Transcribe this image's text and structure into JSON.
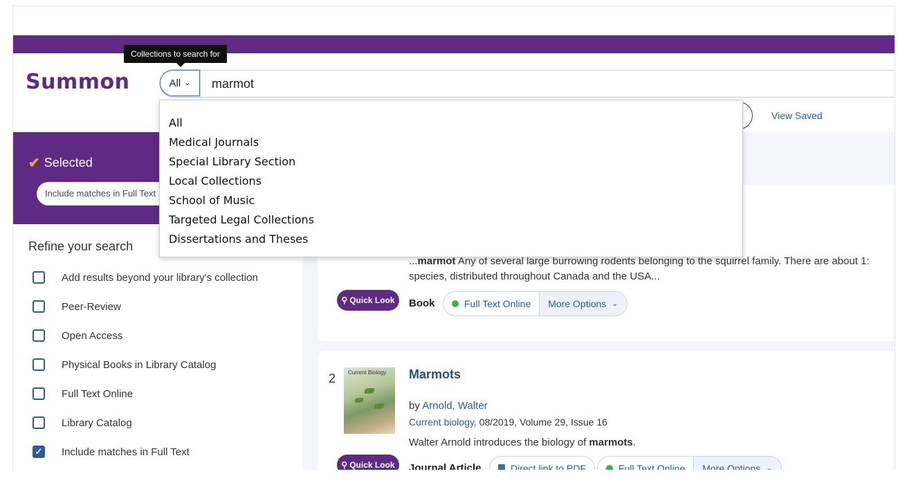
{
  "header": {
    "logo": "Summon",
    "tooltip": "Collections to search for",
    "scope_value": "All",
    "search_value": "marmot",
    "view_saved": "View Saved"
  },
  "scope_options": [
    "All",
    "Medical Journals",
    "Special Library Section",
    "Local Collections",
    "School of Music",
    "Targeted Legal Collections",
    "Dissertations and Theses"
  ],
  "selected": {
    "title": "Selected",
    "chip": "Include matches in Full Text"
  },
  "refine": {
    "title": "Refine your search",
    "facets": [
      {
        "label": "Add results beyond your library's collection",
        "checked": false
      },
      {
        "label": "Peer-Review",
        "checked": false
      },
      {
        "label": "Open Access",
        "checked": false
      },
      {
        "label": "Physical Books in Library Catalog",
        "checked": false
      },
      {
        "label": "Full Text Online",
        "checked": false
      },
      {
        "label": "Library Catalog",
        "checked": false
      },
      {
        "label": "Include matches in Full Text",
        "checked": true
      }
    ]
  },
  "results": [
    {
      "snippet_lead": "...",
      "snippet_bold": "marmot",
      "snippet_rest": " Any of several large burrowing rodents belonging to the squirrel family. There are about 1:",
      "snippet_line2": "species, distributed throughout Canada and the USA...",
      "quick_look": "Quick Look",
      "type": "Book",
      "full_text": "Full Text Online",
      "more_options": "More Options"
    },
    {
      "rank": "2",
      "thumb_title": "Current Biology",
      "title": "Marmots",
      "by": "by ",
      "author": "Arnold, Walter",
      "journal": "Current biology",
      "source_rest": ", 08/2019, Volume 29, Issue 16",
      "desc_lead": "Walter Arnold introduces the biology of ",
      "desc_bold": "marmots",
      "desc_end": ".",
      "quick_look": "Quick Look",
      "type": "Journal Article",
      "pdf": "Direct link to PDF",
      "full_text": "Full Text Online",
      "more_options": "More Options"
    }
  ],
  "colors": {
    "brand_purple": "#5e2a84",
    "link_blue": "#2b5a9a",
    "available_green": "#39b54a",
    "check_orange": "#f5a623"
  }
}
